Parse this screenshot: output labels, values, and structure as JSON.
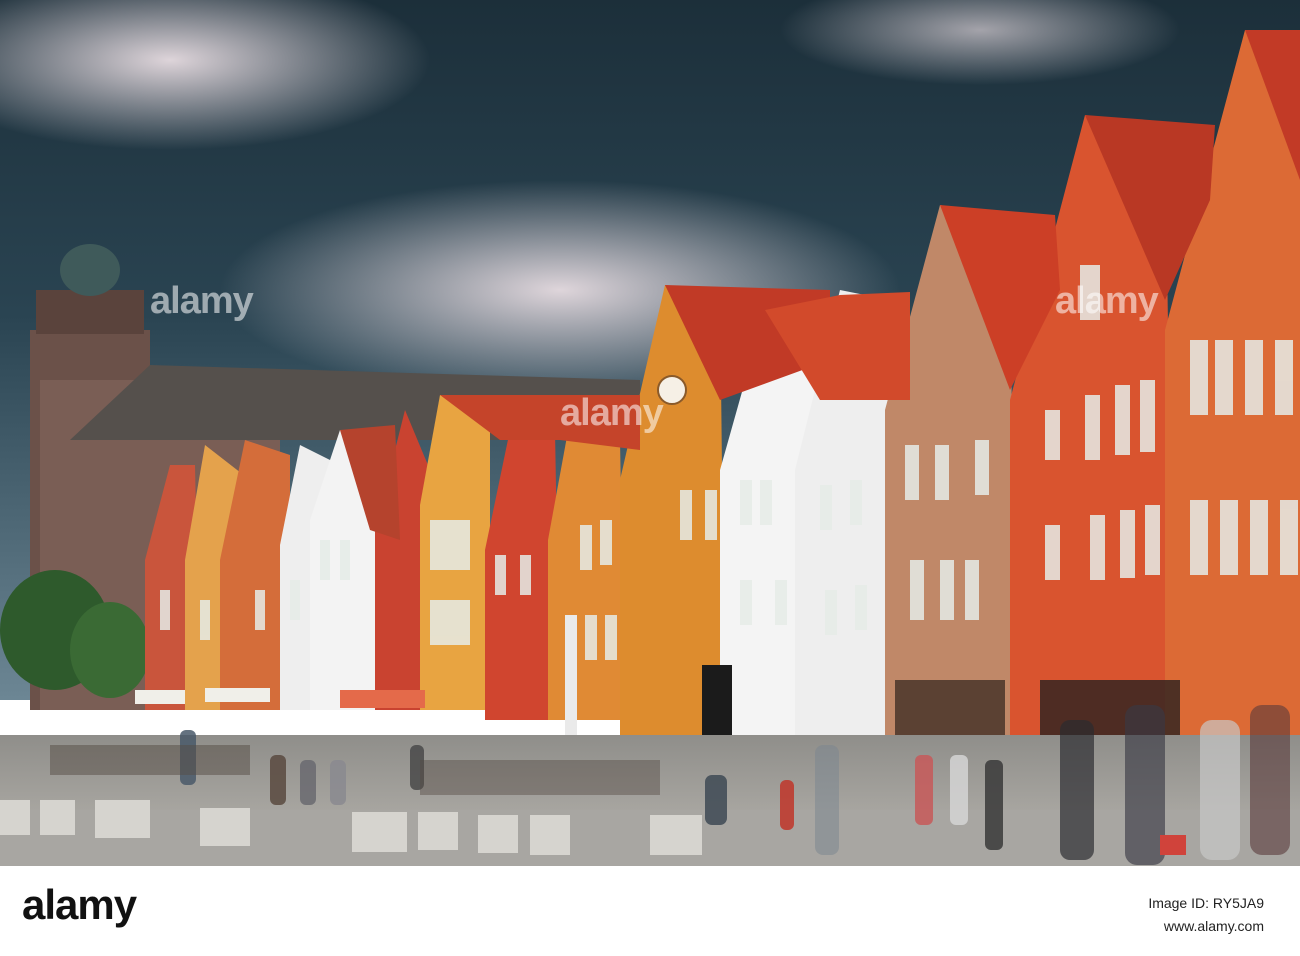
{
  "watermark": {
    "text": "alamy"
  },
  "footer": {
    "logo_text": "alamy",
    "image_id": "Image ID: RY5JA9",
    "site": "www.alamy.com"
  },
  "colors": {
    "sky_top": "#1f3440",
    "cloud": "#d9cfd6",
    "house_red": "#d2442a",
    "house_orange": "#e07a2a",
    "house_yellow": "#e9a040",
    "house_white": "#f2f2f2",
    "roof_red": "#c8311f"
  }
}
